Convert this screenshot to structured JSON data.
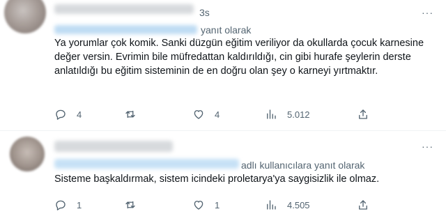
{
  "tweets": [
    {
      "time": "3s",
      "more": "···",
      "reply_to_suffix": "yanıt olarak",
      "text": "Ya yorumlar çok komik. Sanki düzgün eğitim veriliyor da okullarda çocuk karnesine değer versin. Evrimin bile müfredattan kaldırıldığı, cin gibi hurafe şeylerin derste anlatıldığı bu eğitim sisteminin de en doğru olan şey o karneyi yırtmaktır.",
      "actions": {
        "reply_count": "4",
        "retweet_count": "",
        "like_count": "4",
        "views_count": "5.012"
      }
    },
    {
      "more": "···",
      "reply_to_suffix": "adlı kullanıcılara yanıt olarak",
      "text": "Sisteme başkaldırmak, sistem icindeki proletarya'ya saygisizlik ile olmaz.",
      "actions": {
        "reply_count": "1",
        "retweet_count": "",
        "like_count": "1",
        "views_count": "4.505"
      }
    }
  ],
  "icons": [
    "reply-icon",
    "retweet-icon",
    "like-icon",
    "views-icon",
    "share-icon",
    "more-icon"
  ],
  "colors": {
    "text": "#0f1419",
    "secondary": "#536471",
    "divider": "#eff3f4"
  }
}
